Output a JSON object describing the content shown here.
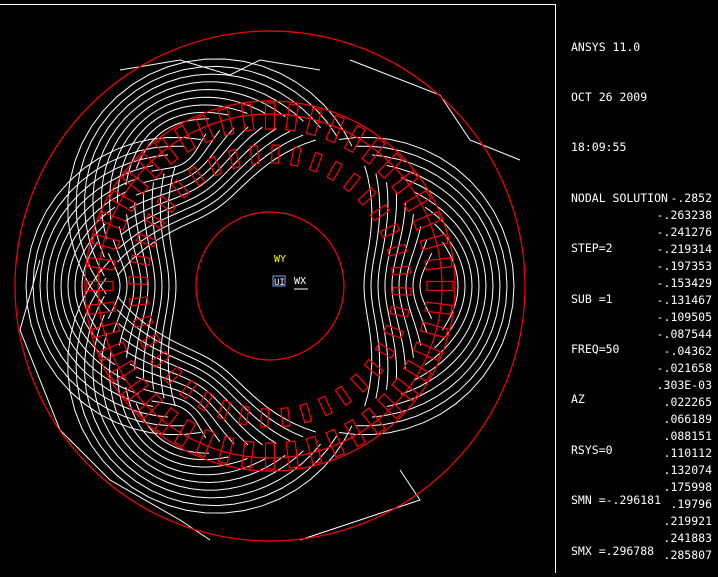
{
  "header": {
    "lines": [
      "ANSYS 11.0",
      "OCT 26 2009",
      "18:09:55",
      "NODAL SOLUTION",
      "STEP=2",
      "SUB =1",
      "FREQ=50",
      "AZ",
      "RSYS=0",
      "SMN =-.296181",
      "SMX =.296788"
    ]
  },
  "legend": {
    "values": [
      "-.2852",
      "-.263238",
      "-.241276",
      "-.219314",
      "-.197353",
      "-.153429",
      "-.131467",
      "-.109505",
      "-.087544",
      "-.04362",
      "-.021658",
      ".303E-03",
      ".022265",
      ".066189",
      ".088151",
      ".110112",
      ".132074",
      ".175998",
      ".19796",
      ".219921",
      ".241883",
      ".285807"
    ]
  },
  "triad": {
    "y_label": "WY",
    "x_label": "WX",
    "origin_label": "UI"
  },
  "colors": {
    "background": "#000000",
    "geometry": "#ff0000",
    "contours": "#ffffff",
    "triad_y": "#ffff00",
    "triad_x": "#ffffff"
  }
}
